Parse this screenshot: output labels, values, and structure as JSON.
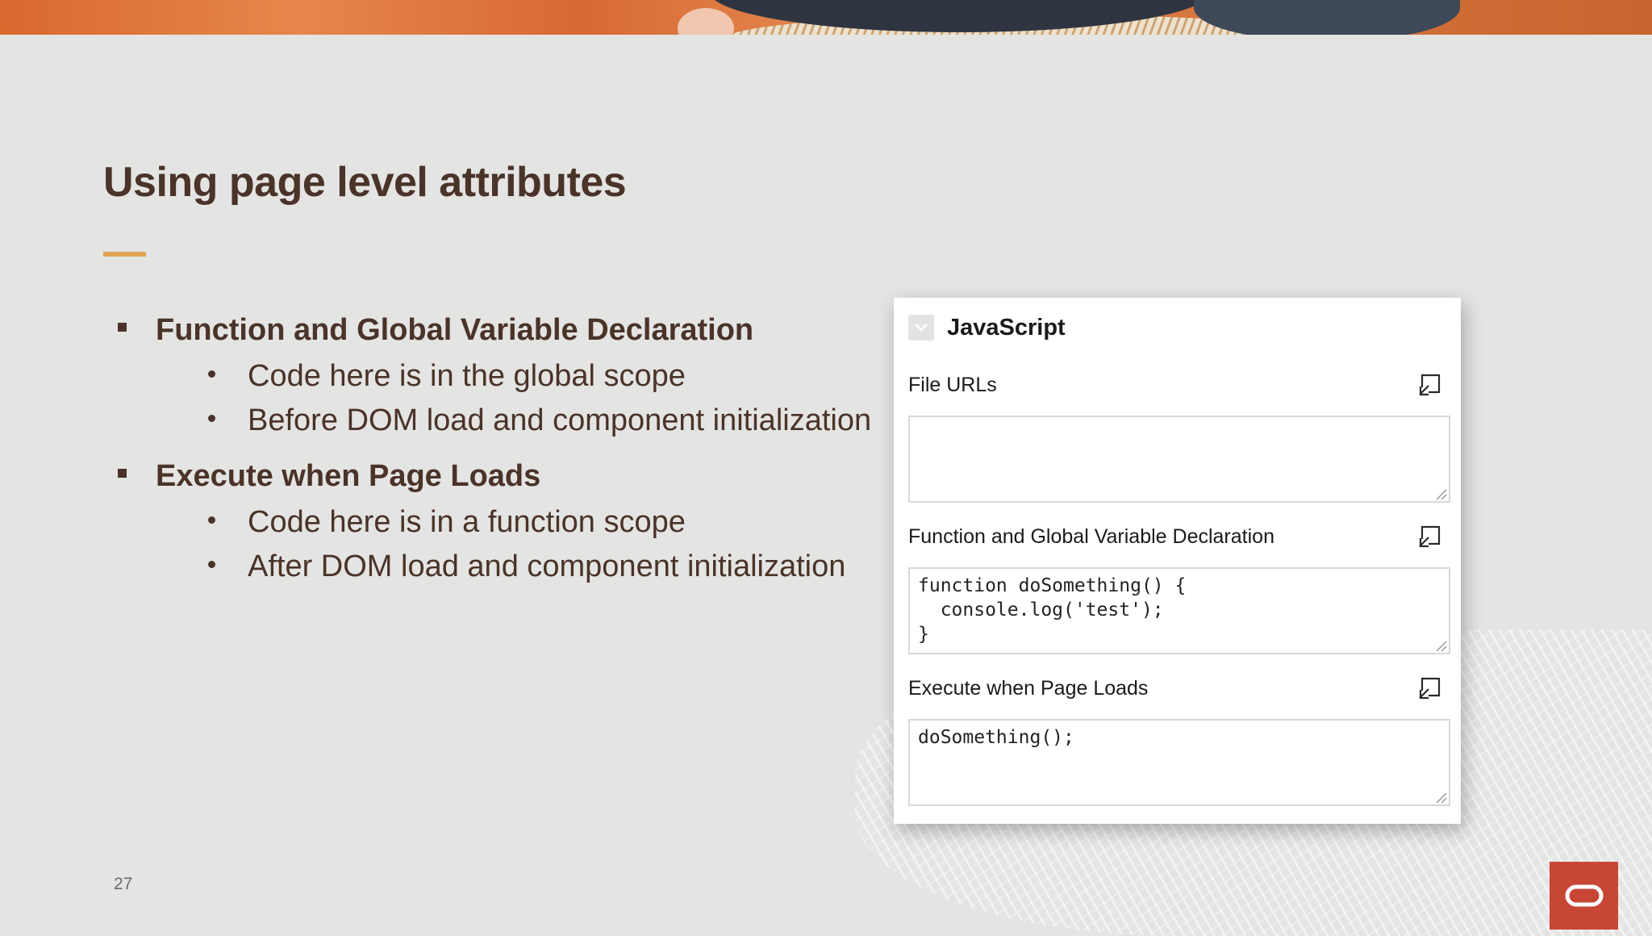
{
  "slide": {
    "title": "Using page level attributes",
    "page_number": "27",
    "accent_color": "#e0a552",
    "text_color": "#4a3328"
  },
  "bullets": [
    {
      "heading": "Function and Global Variable Declaration",
      "items": [
        "Code here is in the global scope",
        "Before DOM load and component initialization"
      ]
    },
    {
      "heading": "Execute when Page Loads",
      "items": [
        "Code here is in a function scope",
        "After DOM load and component initialization"
      ]
    }
  ],
  "panel": {
    "title": "JavaScript",
    "collapse_icon": "chevron-down-icon",
    "expand_icon": "expand-icon",
    "fields": [
      {
        "label": "File URLs",
        "value": ""
      },
      {
        "label": "Function and Global Variable Declaration",
        "value": "function doSomething() {\n  console.log('test');\n}"
      },
      {
        "label": "Execute when Page Loads",
        "value": "doSomething();"
      }
    ]
  },
  "logo": {
    "brand_color": "#c74634",
    "icon": "oracle-logo"
  }
}
